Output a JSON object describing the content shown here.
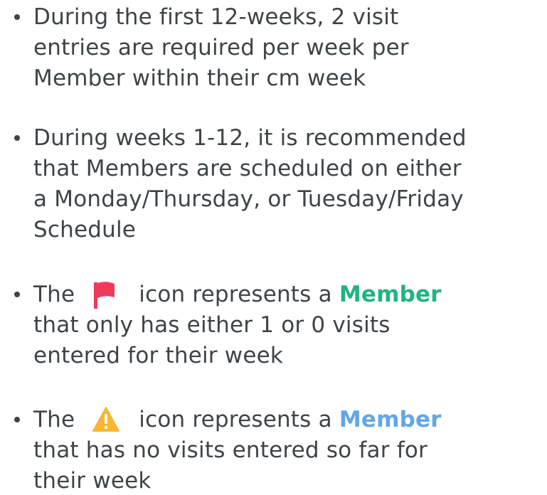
{
  "bullets": [
    {
      "lines": [
        "During the first 12-weeks, 2 visit",
        "entries are required per week per",
        "Member within their cm week"
      ]
    },
    {
      "lines": [
        "During weeks 1-12, it is recommended",
        "that Members are scheduled on either",
        "a Monday/Thursday, or Tuesday/Friday",
        "Schedule"
      ]
    },
    {
      "prefix": "The",
      "icon": "red-flag-icon",
      "middle": "icon represents a",
      "highlight": "Member",
      "highlight_color": "#1fb57f",
      "lines": [
        "that only has either 1 or 0 visits",
        "entered for their week"
      ]
    },
    {
      "prefix": "The",
      "icon": "warning-triangle-icon",
      "middle": "icon represents a",
      "highlight": "Member",
      "highlight_color": "#62a6e8",
      "lines": [
        "that has no visits entered so far for",
        "their week"
      ]
    }
  ],
  "colors": {
    "text": "#3d4448",
    "flag": "#ee3a5b",
    "warning_fill": "#f7b731",
    "warning_mark": "#ffffff"
  }
}
